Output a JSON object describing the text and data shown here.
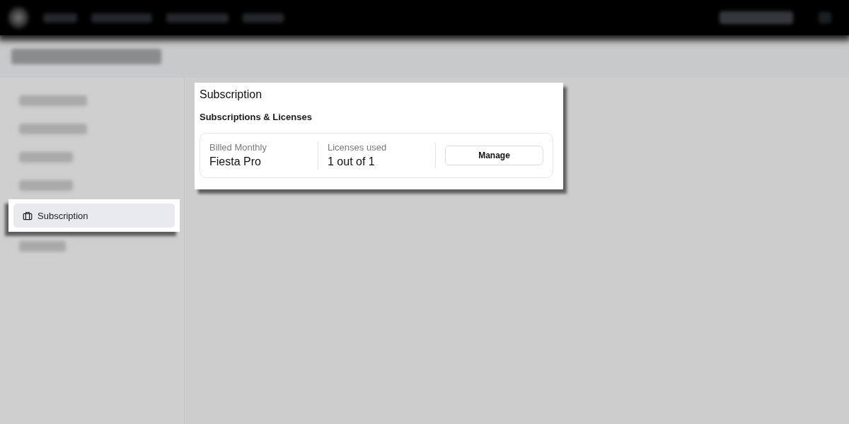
{
  "sidebar": {
    "items": [
      {
        "kind": "blurred"
      },
      {
        "kind": "blurred"
      },
      {
        "kind": "blurred"
      },
      {
        "kind": "blurred"
      },
      {
        "kind": "link",
        "label": "Subscription",
        "selected": true,
        "spotlighted": true
      },
      {
        "kind": "blurred"
      }
    ]
  },
  "panel": {
    "spotlighted": true,
    "title": "Subscription",
    "section_title": "Subscriptions & Licenses",
    "fields": [
      {
        "label": "Billed Monthly",
        "value": "Fiesta Pro"
      },
      {
        "label": "Licenses used",
        "value": "1 out of 1"
      }
    ],
    "button": "Manage"
  }
}
